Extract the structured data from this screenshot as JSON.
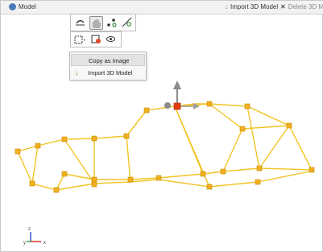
{
  "titlebar": {
    "title": "Model",
    "import_label": "Import 3D Model",
    "delete_label": "Delete 3D Mo"
  },
  "context_menu": {
    "items": [
      {
        "label": "Copy as Image",
        "highlighted": true
      },
      {
        "label": "Import 3D Model",
        "icon": "import-arrow-icon"
      }
    ]
  },
  "axis_triad": {
    "z": "z",
    "y": "y",
    "x": "x"
  },
  "colors": {
    "wire": "#f2c424",
    "node": "#f0b020",
    "node_edge": "#c98a00",
    "selected_node": "#e53a12",
    "import_arrow": "#5aa02c",
    "delete_x": "#555555",
    "axis_z": "#3b57c9",
    "axis_x": "#d23a2a"
  }
}
